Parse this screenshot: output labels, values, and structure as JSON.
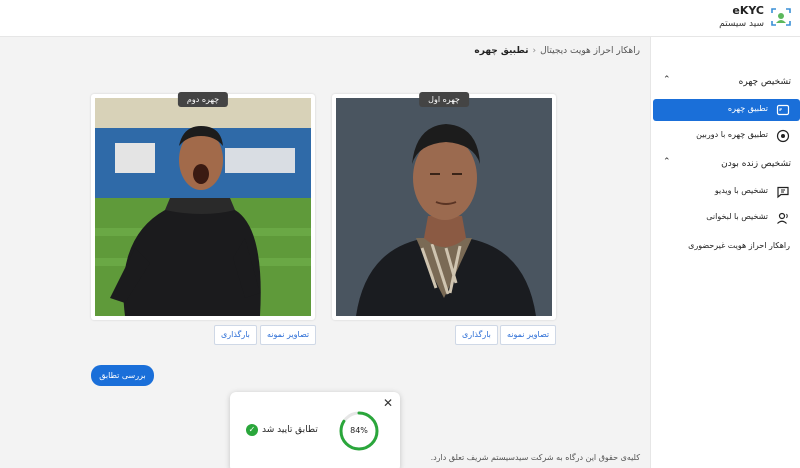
{
  "header": {
    "brand_title": "eKYC",
    "brand_subtitle": "سید سیستم"
  },
  "breadcrumb": {
    "parent": "راهکار احراز هویت دیجیتال",
    "current": "تطبیق چهره"
  },
  "cards": [
    {
      "tag": "چهره اول",
      "samples_label": "تصاویر نمونه",
      "upload_label": "بارگذاری"
    },
    {
      "tag": "چهره دوم",
      "samples_label": "تصاویر نمونه",
      "upload_label": "بارگذاری"
    }
  ],
  "actions": {
    "check_match_label": "بررسی تطابق"
  },
  "footer": {
    "text": "کلیه‌ی حقوق این درگاه به شرکت سیدسیستم شریف تعلق دارد."
  },
  "popup": {
    "status_text": "تطابق تایید شد",
    "score_label": "84%",
    "score_value": 0.84
  },
  "sidebar": {
    "sections": [
      {
        "label": "تشخیص چهره",
        "items": [
          {
            "label": "تطبیق چهره",
            "icon": "image-frame-icon",
            "active": true
          },
          {
            "label": "تطبیق چهره با دوربین",
            "icon": "camera-lens-icon",
            "active": false
          }
        ]
      },
      {
        "label": "تشخیص زنده بودن",
        "items": [
          {
            "label": "تشخیص با ویدیو",
            "icon": "video-chat-icon",
            "active": false
          },
          {
            "label": "تشخیص با لبخوانی",
            "icon": "speaking-person-icon",
            "active": false
          }
        ]
      }
    ],
    "extra": "راهکار احراز هویت غیرحضوری"
  },
  "colors": {
    "primary": "#1a6fd9",
    "success": "#2aa63b",
    "background": "#f3f3f3"
  }
}
